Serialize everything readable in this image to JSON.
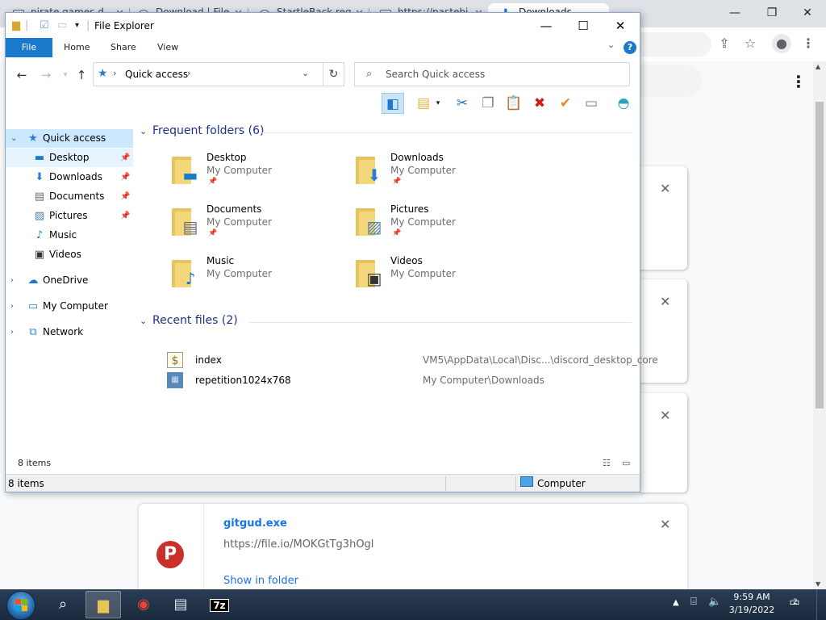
{
  "chrome": {
    "tabs": [
      {
        "label": "pirate games d...",
        "icon": "page-icon"
      },
      {
        "label": "Download | File...",
        "icon": "globe-icon"
      },
      {
        "label": "StartleBack req...",
        "icon": "globe-icon"
      },
      {
        "label": "https://pastebi...",
        "icon": "page-icon"
      },
      {
        "label": "Downloads",
        "icon": "download-icon",
        "active": true
      }
    ],
    "downloads": {
      "visible_card": {
        "filename": "gitgud.exe",
        "url": "https://file.io/MOKGtTg3hOgl",
        "action": "Show in folder"
      }
    }
  },
  "explorer": {
    "title": "File Explorer",
    "ribbon_tabs": [
      "File",
      "Home",
      "Share",
      "View"
    ],
    "address": {
      "location": "Quick access"
    },
    "search": {
      "placeholder": "Search Quick access"
    },
    "nav": {
      "quick_access": "Quick access",
      "pinned": [
        "Desktop",
        "Downloads",
        "Documents",
        "Pictures"
      ],
      "unpinned": [
        "Music",
        "Videos"
      ],
      "roots": [
        "OneDrive",
        "My Computer",
        "Network"
      ]
    },
    "frequent": {
      "header": "Frequent folders (6)",
      "items": [
        {
          "name": "Desktop",
          "location": "My Computer"
        },
        {
          "name": "Downloads",
          "location": "My Computer"
        },
        {
          "name": "Documents",
          "location": "My Computer"
        },
        {
          "name": "Pictures",
          "location": "My Computer"
        },
        {
          "name": "Music",
          "location": "My Computer"
        },
        {
          "name": "Videos",
          "location": "My Computer"
        }
      ]
    },
    "recent": {
      "header": "Recent files (2)",
      "items": [
        {
          "name": "index",
          "path": "VM5\\AppData\\Local\\Disc...\\discord_desktop_core"
        },
        {
          "name": "repetition1024x768",
          "path": "My Computer\\Downloads"
        }
      ]
    },
    "status": {
      "inner_count": "8 items",
      "outer_count": "8 items",
      "zone": "Computer"
    }
  },
  "taskbar": {
    "apps": [
      "search",
      "file-explorer",
      "chrome",
      "notepad",
      "7-zip"
    ],
    "time": "9:59 AM",
    "date": "3/19/2022",
    "notifications": "2"
  },
  "colors": {
    "accent": "#1979ca",
    "selection": "#cce8ff",
    "link": "#1a73e8",
    "group_header": "#1e3287"
  }
}
